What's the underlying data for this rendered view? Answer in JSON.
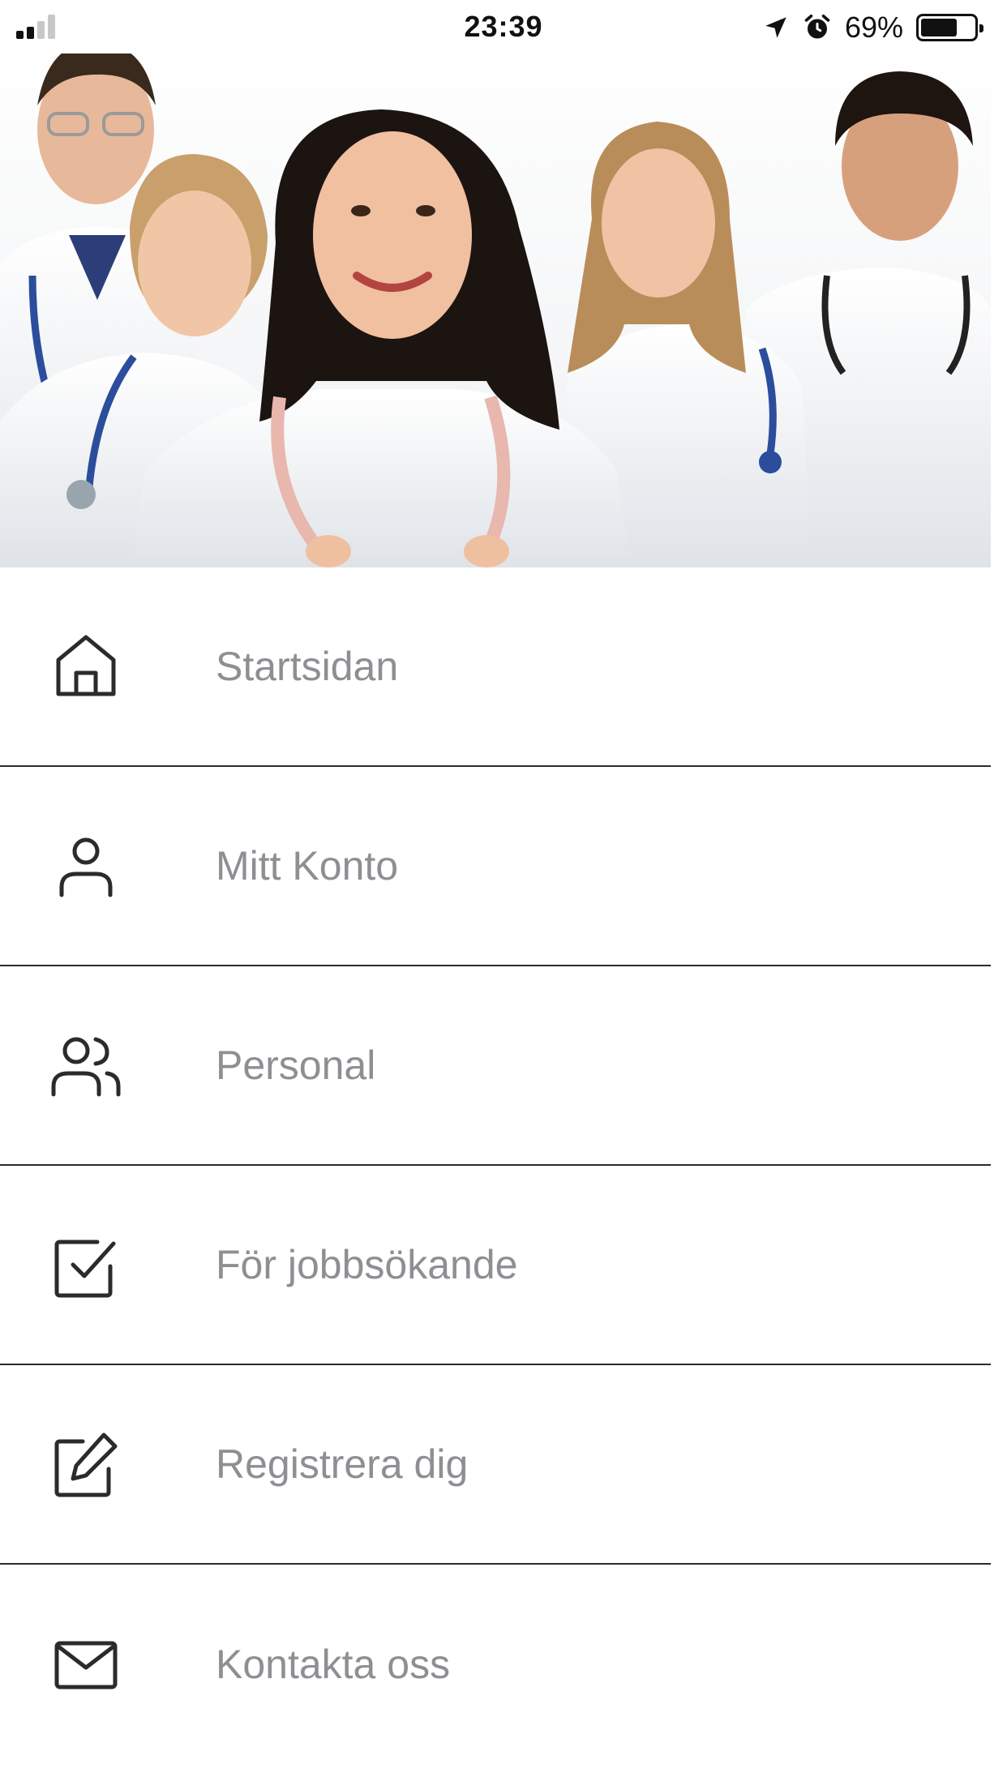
{
  "status_bar": {
    "time": "23:39",
    "battery_percent": "69%",
    "battery_level": 0.69,
    "signal_bars_active": 2,
    "signal_bars_total": 4,
    "icons": [
      "signal-bars-icon",
      "location-arrow-icon",
      "alarm-icon",
      "battery-icon"
    ]
  },
  "hero": {
    "image": "group-of-doctors-photo"
  },
  "menu": {
    "items": [
      {
        "label": "Startsidan",
        "icon": "home-icon"
      },
      {
        "label": "Mitt Konto",
        "icon": "user-icon"
      },
      {
        "label": "Personal",
        "icon": "users-icon"
      },
      {
        "label": "För jobbsökande",
        "icon": "check-square-icon"
      },
      {
        "label": "Registrera dig",
        "icon": "edit-icon"
      },
      {
        "label": "Kontakta oss",
        "icon": "mail-icon"
      }
    ]
  },
  "colors": {
    "label_gray": "#8e8e93",
    "icon_dark": "#2b2b2b",
    "divider": "#2b2b2b",
    "background": "#ffffff"
  }
}
